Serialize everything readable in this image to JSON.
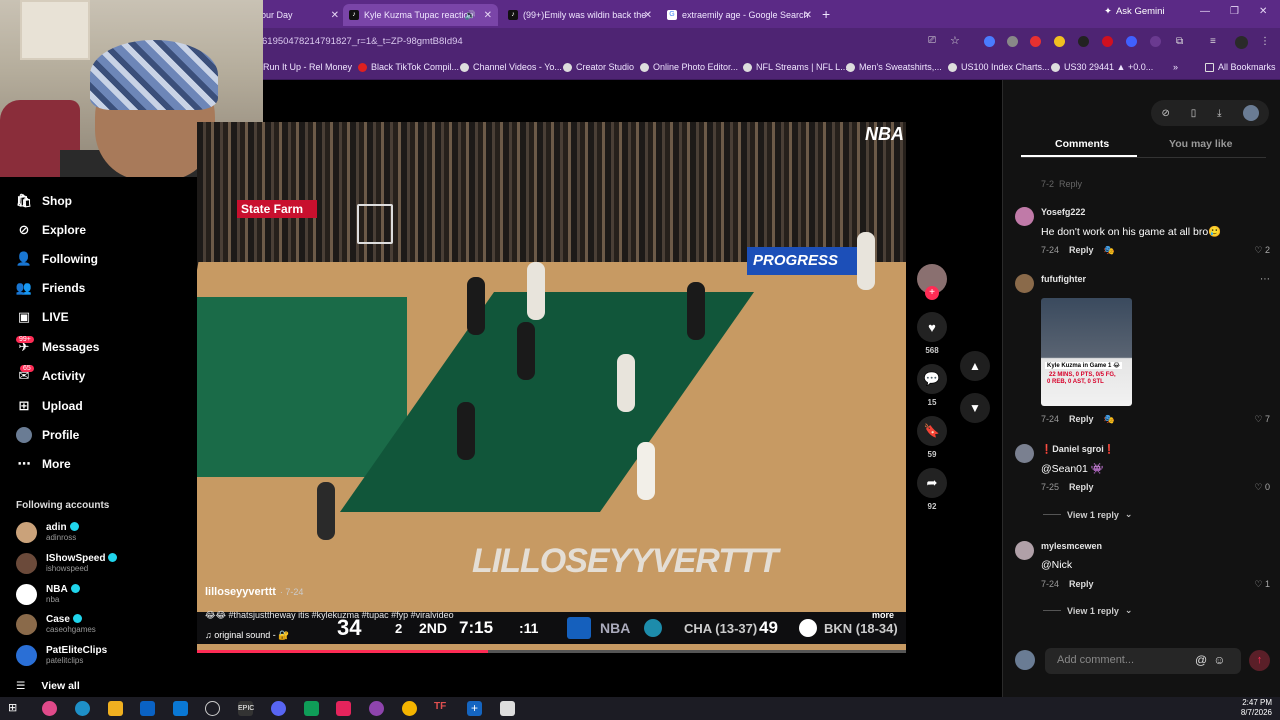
{
  "browser": {
    "tabs": [
      {
        "title": "our Day",
        "active": false
      },
      {
        "title": "Kyle Kuzma Tupac reaction",
        "active": true
      },
      {
        "title": "(99+)Emily was wildin back the",
        "active": false
      },
      {
        "title": "extraemily age - Google Search",
        "active": false
      }
    ],
    "new_tab": "+",
    "gemini_label": "Ask Gemini",
    "url": "61950478214791827_r=1&_t=ZP-98gmtB8Id94",
    "bookmarks": [
      "Run It Up - Rel Money",
      "Black TikTok Compil...",
      "Channel Videos - Yo...",
      "Creator Studio",
      "Online Photo Editor...",
      "NFL Streams | NFL L...",
      "Men's Sweatshirts,...",
      "US100 Index Charts...",
      "US30 29441 ▲ +0.0..."
    ],
    "all_bookmarks": "All Bookmarks"
  },
  "sidebar": {
    "items": [
      {
        "label": "Shop",
        "icon": "shop-icon"
      },
      {
        "label": "Explore",
        "icon": "compass-icon"
      },
      {
        "label": "Following",
        "icon": "following-icon"
      },
      {
        "label": "Friends",
        "icon": "friends-icon"
      },
      {
        "label": "LIVE",
        "icon": "live-icon"
      },
      {
        "label": "Messages",
        "icon": "messages-icon",
        "badge": "99+"
      },
      {
        "label": "Activity",
        "icon": "activity-icon",
        "badge": "65"
      },
      {
        "label": "Upload",
        "icon": "upload-icon"
      },
      {
        "label": "Profile",
        "icon": "profile-avatar"
      },
      {
        "label": "More",
        "icon": "more-icon"
      }
    ],
    "following_title": "Following accounts",
    "accounts": [
      {
        "name": "adin",
        "handle": "adinross",
        "verified": true,
        "color": "#caa27a"
      },
      {
        "name": "IShowSpeed",
        "handle": "ishowspeed",
        "verified": true,
        "color": "#6b4a3a"
      },
      {
        "name": "NBA",
        "handle": "nba",
        "verified": true,
        "color": "#ffffff"
      },
      {
        "name": "Case",
        "handle": "caseohgames",
        "verified": true,
        "color": "#8a6a4a"
      },
      {
        "name": "PatEliteClips",
        "handle": "patelitclips",
        "verified": false,
        "color": "#2a6fd6"
      }
    ],
    "view_all": "View all"
  },
  "video": {
    "author": "lilloseyyverttt",
    "date": "· 7-24",
    "caption": "😂😂 #thatsjusttheway itis #kylekuzma #tupac #fyp #viralvideo",
    "sound": "♫ original sound - 🔐",
    "more": "more",
    "watermark": "LILLOSEYYVERTTT",
    "broadcaster": "NBA",
    "scoreboard": {
      "home_score": "34",
      "timeouts": "2",
      "quarter": "2ND",
      "clock": "7:15",
      "shot_clock": ":11",
      "league": "NBA",
      "team_a": "CHA (13-37)",
      "team_a_score": "49",
      "team_b": "BKN (18-34)"
    },
    "progress_fraction": 0.41
  },
  "actions": {
    "likes": "568",
    "comments": "15",
    "saves": "59",
    "shares": "92"
  },
  "panel": {
    "tabs": [
      "Comments",
      "You may like"
    ],
    "comments": [
      {
        "user": "Yosefg222",
        "text": "He don't work on his game at all bro🥲",
        "date": "7-24",
        "reply": "Reply",
        "likes": "2",
        "color": "#c07aa8"
      },
      {
        "user": "fufufighter",
        "text": "",
        "date": "7-24",
        "reply": "Reply",
        "likes": "7",
        "color": "#8a6a4a",
        "image_caption": [
          "Kyle Kuzma in Game 1 😂",
          "22 MINS, 0 PTS, 0/5 FG,",
          "0 REB, 0 AST, 0 STL"
        ]
      },
      {
        "user": "❗Daniel sgroi❗",
        "text": "@Sean01 👾",
        "date": "7-25",
        "reply": "Reply",
        "likes": "0",
        "color": "#7a8090"
      },
      {
        "user": "mylesmcewen",
        "text": "@Nick",
        "date": "7-24",
        "reply": "Reply",
        "likes": "1",
        "color": "#b0a0a8"
      }
    ],
    "view_replies": "View 1 reply",
    "add_comment_placeholder": "Add comment..."
  },
  "taskbar": {
    "time": "2:47 PM",
    "date": "8/7/2026"
  }
}
